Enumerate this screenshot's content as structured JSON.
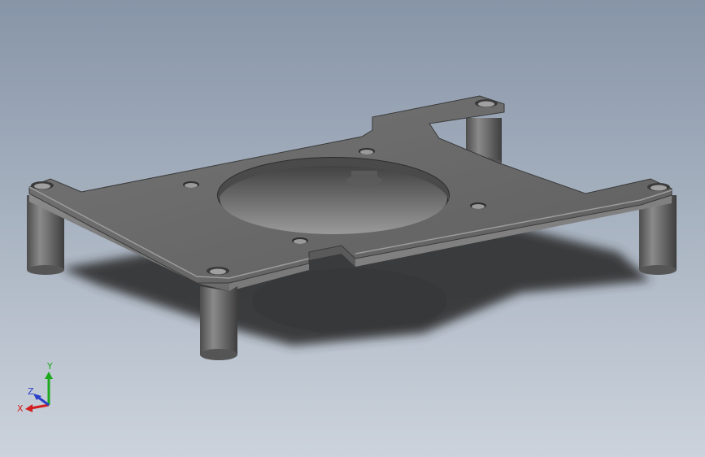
{
  "viewport": {
    "background_top": "#8795a8",
    "background_bottom": "#ccd3dc",
    "part_color": "#6a6a6a"
  },
  "model": {
    "name": "motor-mount-plate",
    "legs": 4,
    "center_bore": true,
    "mounting_holes": 4
  },
  "triad": {
    "x_label": "X",
    "y_label": "Y",
    "z_label": "Z",
    "x_color": "#d21f1f",
    "y_color": "#1fa81f",
    "z_color": "#2b3fc8"
  }
}
